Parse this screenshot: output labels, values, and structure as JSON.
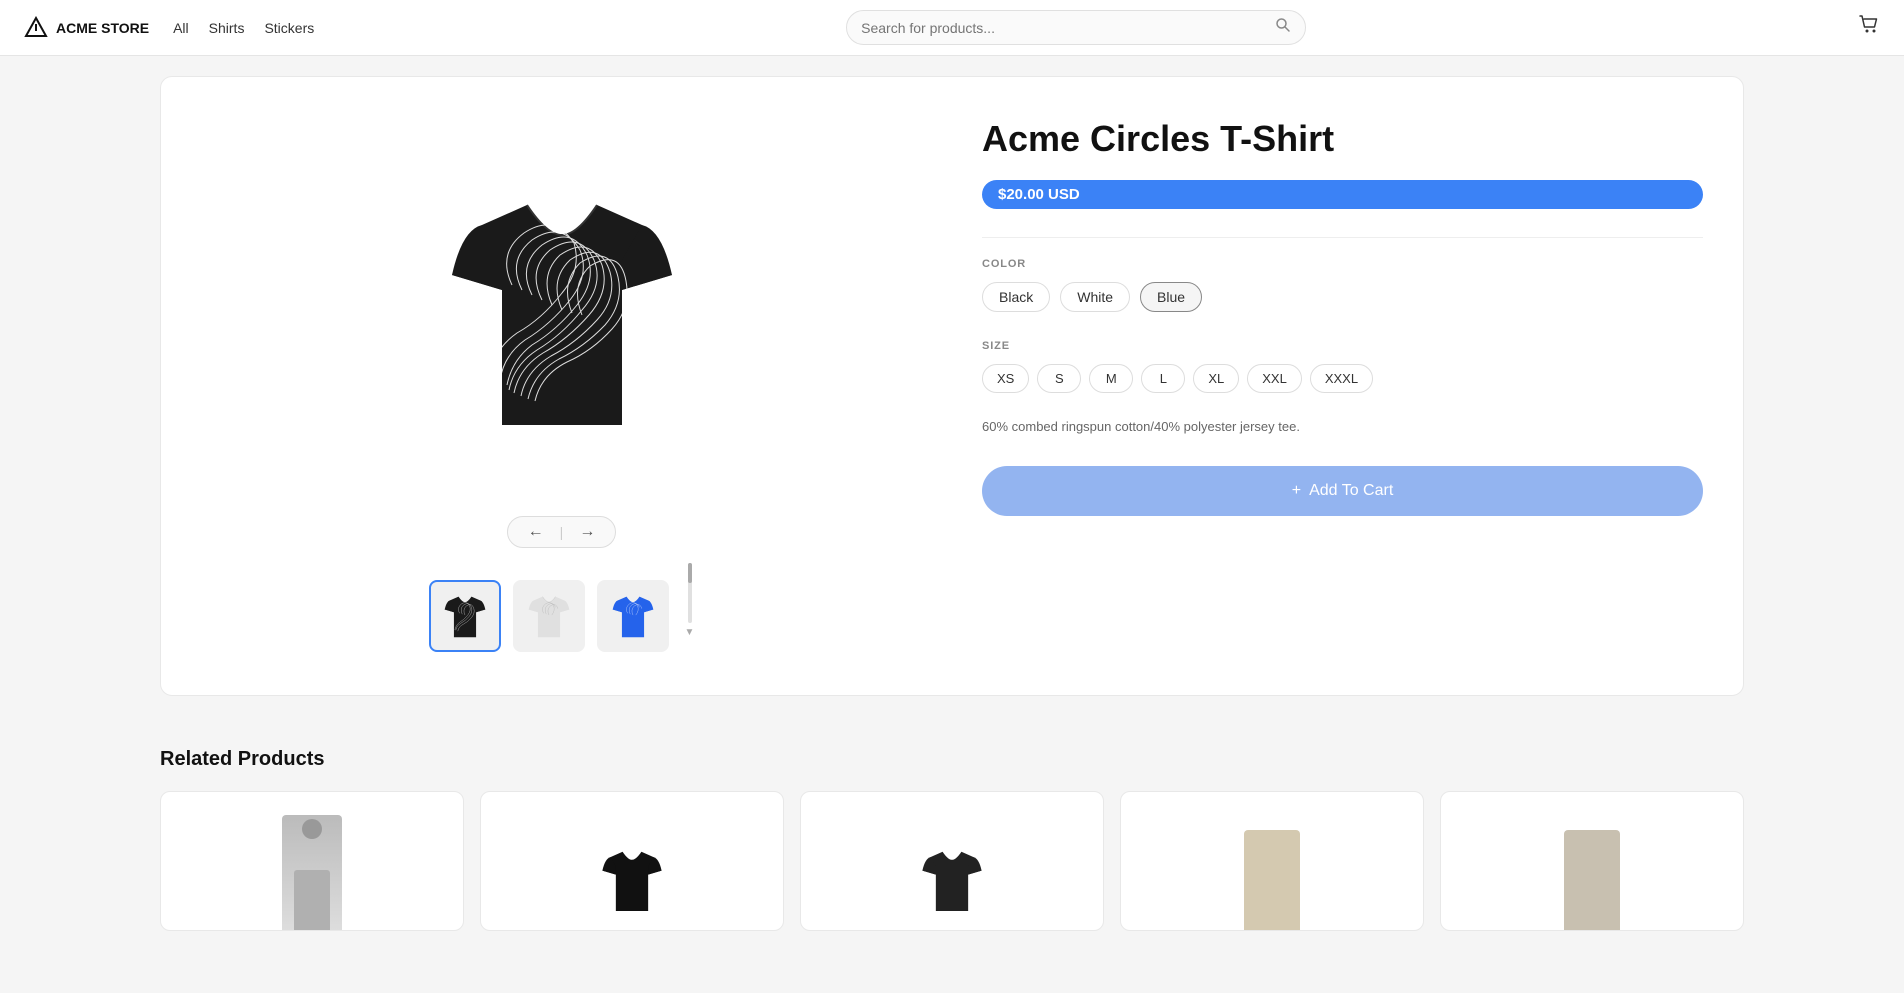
{
  "header": {
    "brand": "ACME STORE",
    "nav": [
      {
        "label": "All",
        "active": false
      },
      {
        "label": "Shirts",
        "active": true
      },
      {
        "label": "Stickers",
        "active": false
      }
    ],
    "search_placeholder": "Search for products..."
  },
  "product": {
    "title": "Acme Circles T-Shirt",
    "price": "$20.00 USD",
    "color_label": "COLOR",
    "colors": [
      {
        "label": "Black",
        "selected": false
      },
      {
        "label": "White",
        "selected": false
      },
      {
        "label": "Blue",
        "selected": true
      }
    ],
    "size_label": "SIZE",
    "sizes": [
      {
        "label": "XS",
        "selected": false
      },
      {
        "label": "S",
        "selected": false
      },
      {
        "label": "M",
        "selected": false
      },
      {
        "label": "L",
        "selected": false
      },
      {
        "label": "XL",
        "selected": false
      },
      {
        "label": "XXL",
        "selected": false
      },
      {
        "label": "XXXL",
        "selected": false
      }
    ],
    "description": "60% combed ringspun cotton/40% polyester jersey tee.",
    "add_to_cart_label": "Add To Cart"
  },
  "related": {
    "title": "Related Products"
  },
  "icons": {
    "search": "🔍",
    "cart": "🛒",
    "plus": "+",
    "arrow_left": "←",
    "arrow_right": "→"
  }
}
